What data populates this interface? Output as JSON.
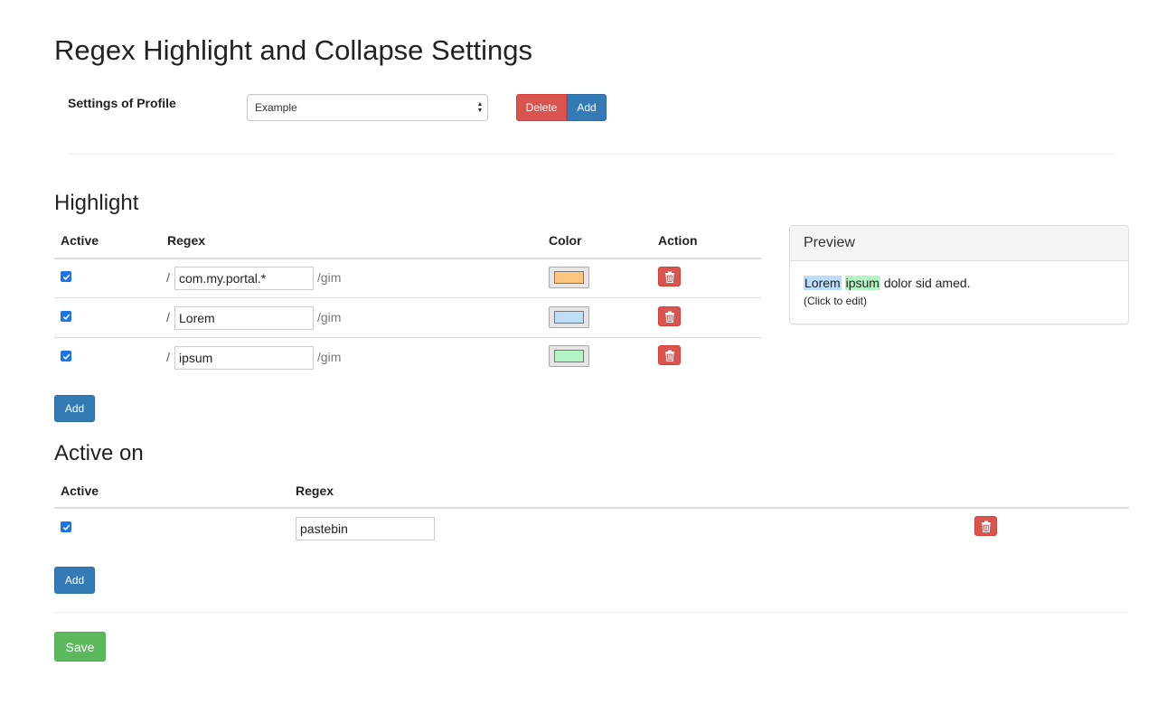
{
  "page_title": "Regex Highlight and Collapse Settings",
  "profile": {
    "label": "Settings of Profile",
    "selected": "Example",
    "delete_label": "Delete",
    "add_label": "Add"
  },
  "highlight": {
    "heading": "Highlight",
    "columns": {
      "active": "Active",
      "regex": "Regex",
      "color": "Color",
      "action": "Action"
    },
    "rows": [
      {
        "active": true,
        "slash": "/",
        "pattern": "com.my.portal.*",
        "flags": "/gim",
        "color": "#ffc57f"
      },
      {
        "active": true,
        "slash": "/",
        "pattern": "Lorem",
        "flags": "/gim",
        "color": "#bcdefa"
      },
      {
        "active": true,
        "slash": "/",
        "pattern": "ipsum",
        "flags": "/gim",
        "color": "#b5f5c5"
      }
    ],
    "add_label": "Add"
  },
  "preview": {
    "heading": "Preview",
    "words": [
      "Lorem",
      "ipsum"
    ],
    "rest": "dolor sid amed.",
    "hint": "(Click to edit)"
  },
  "active_on": {
    "heading": "Active on",
    "columns": {
      "active": "Active",
      "regex": "Regex"
    },
    "rows": [
      {
        "active": true,
        "pattern": "pastebin"
      }
    ],
    "add_label": "Add"
  },
  "save_label": "Save",
  "colors": {
    "primary": "#337ab7",
    "danger": "#d9534f",
    "success": "#5cb85c",
    "checkbox": "#1a73e8"
  }
}
